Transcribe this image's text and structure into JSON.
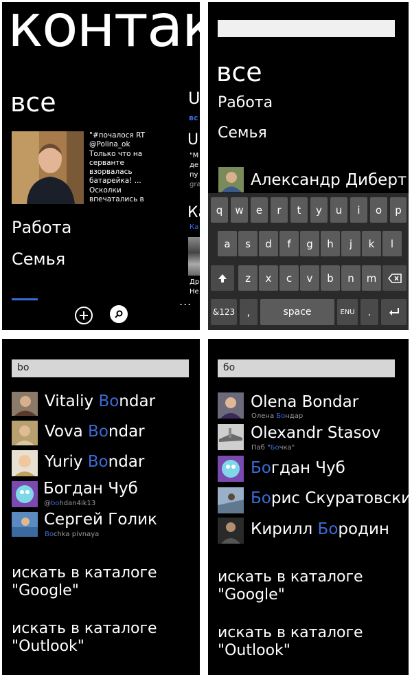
{
  "panel1": {
    "header": "контак",
    "pivot_current": "все",
    "pivot_next_title_fragment": "U",
    "pivot_next_line": "вс",
    "social_status_lines": [
      "\"#почалося RT",
      "@Polina_ok",
      "Только что на",
      "серванте",
      "взорвалась",
      "батарейка! ...",
      "Осколки",
      "впечатались в"
    ],
    "side_fragments": [
      "U",
      "\"М",
      "де",
      "пу",
      "gra",
      "Ка",
      "Ка",
      "Др",
      "Не"
    ],
    "groups": [
      "Работа",
      "Семья"
    ],
    "more_dots": "...",
    "add_icon": "plus-icon",
    "search_icon": "search-icon"
  },
  "panel2": {
    "search_value": "",
    "pivot_current": "все",
    "groups": [
      "Работа",
      "Семья"
    ],
    "contact": "Александр Диберт",
    "keyboard": {
      "row1": [
        "q",
        "w",
        "e",
        "r",
        "t",
        "y",
        "u",
        "i",
        "o",
        "p"
      ],
      "row2": [
        "a",
        "s",
        "d",
        "f",
        "g",
        "h",
        "j",
        "k",
        "l"
      ],
      "row3": [
        "z",
        "x",
        "c",
        "v",
        "b",
        "n",
        "m"
      ],
      "shift_icon": "shift-arrow-icon",
      "backspace_icon": "backspace-icon",
      "key_123": "&123",
      "key_comma": ",",
      "key_space": "space",
      "key_lang": "ENU",
      "key_dot": ".",
      "enter_icon": "enter-icon"
    }
  },
  "panel3": {
    "search_value": "bo",
    "results": [
      {
        "pre": "Vitaliy ",
        "match": "Bo",
        "post": "ndar",
        "sub_match": "",
        "sub_rest": ""
      },
      {
        "pre": "Vova ",
        "match": "Bo",
        "post": "ndar",
        "sub_match": "",
        "sub_rest": ""
      },
      {
        "pre": "Yuriy ",
        "match": "Bo",
        "post": "ndar",
        "sub_match": "",
        "sub_rest": ""
      },
      {
        "pre": "Богдан Чуб",
        "match": "",
        "post": "",
        "sub_pre": "@",
        "sub_match": "bo",
        "sub_rest": "hdan4ik13"
      },
      {
        "pre": "Сергей Голик",
        "match": "",
        "post": "",
        "sub_pre": "",
        "sub_match": "Bo",
        "sub_rest": "chka pivnaya"
      }
    ],
    "catalog_google": [
      "искать в каталоге",
      "\"Google\""
    ],
    "catalog_outlook": [
      "искать в каталоге",
      "\"Outlook\""
    ]
  },
  "panel4": {
    "search_value": "бо",
    "results": [
      {
        "pre": "Olena Bondar",
        "match": "",
        "post": "",
        "sub_pre": "Олена ",
        "sub_match": "Бо",
        "sub_rest": "ндар"
      },
      {
        "pre": "Olexandr Stasov",
        "match": "",
        "post": "",
        "sub_pre": "Паб \"",
        "sub_match": "Бо",
        "sub_rest": "чка\""
      },
      {
        "pre": "",
        "match": "Бо",
        "post": "гдан Чуб"
      },
      {
        "pre": "",
        "match": "Бо",
        "post": "рис Скуратовский"
      },
      {
        "pre": "Кирилл ",
        "match": "Бо",
        "post": "родин"
      }
    ],
    "catalog_google": [
      "искать в каталоге",
      "\"Google\""
    ],
    "catalog_outlook": [
      "искать в каталоге",
      "\"Outlook\""
    ]
  },
  "colors": {
    "accent": "#3b6bd8",
    "background": "#000000",
    "search_box": "#d6d6d6",
    "keyboard_key": "#5b5b5b"
  }
}
